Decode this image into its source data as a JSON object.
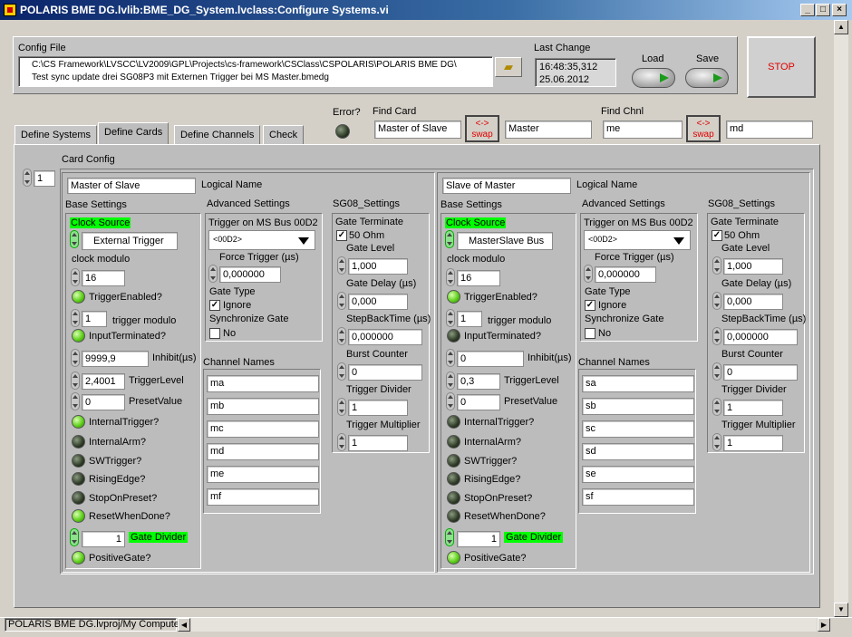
{
  "window": {
    "title": "POLARIS BME DG.lvlib:BME_DG_System.lvclass:Configure Systems.vi",
    "min": "_",
    "max": "□",
    "close": "×"
  },
  "config": {
    "label": "Config File",
    "path_line1": "C:\\CS Framework\\LVSCC\\LV2009\\GPL\\Projects\\cs-framework\\CSClass\\CSPOLARIS\\POLARIS BME DG\\",
    "path_line2": "Test sync update drei SG08P3 mit Externen Trigger bei MS Master.bmedg",
    "last_change_label": "Last Change",
    "time": "16:48:35,312",
    "date": "25.06.2012",
    "load": "Load",
    "save": "Save",
    "stop": "STOP"
  },
  "tabs": [
    "Define Systems",
    "Define Cards",
    "Define Channels",
    "Check"
  ],
  "error_label": "Error?",
  "find_card": {
    "label": "Find Card",
    "left": "Master of Slave",
    "swap": "<->\nswap",
    "right": "Master"
  },
  "find_chnl": {
    "label": "Find Chnl",
    "left": "me",
    "swap": "<->\nswap",
    "right": "md"
  },
  "card_config_label": "Card Config",
  "index": "1",
  "common": {
    "logical_name": "Logical Name",
    "base": "Base Settings",
    "adv": "Advanced Settings",
    "sg08": "SG08_Settings",
    "clock_source": "Clock Source",
    "clock_modulo": "clock modulo",
    "trigger_enabled": "TriggerEnabled?",
    "trigger_modulo": "trigger modulo",
    "input_terminated": "InputTerminated?",
    "inhibit": "Inhibit(µs)",
    "trigger_level": "TriggerLevel",
    "preset_value": "PresetValue",
    "internal_trigger": "InternalTrigger?",
    "internal_arm": "InternalArm?",
    "sw_trigger": "SWTrigger?",
    "rising_edge": "RisingEdge?",
    "stop_on_preset": "StopOnPreset?",
    "reset_when_done": "ResetWhenDone?",
    "gate_divider": "Gate Divider",
    "positive_gate": "PositiveGate?",
    "trig_ms": "Trigger on MS Bus 00D2",
    "ring": "<00D2>",
    "force_trigger": "Force Trigger (µs)",
    "gate_type": "Gate Type",
    "ignore": "Ignore",
    "sync_gate": "Synchronize Gate",
    "no": "No",
    "channel_names": "Channel Names",
    "gate_terminate": "Gate Terminate",
    "ohm": "50 Ohm",
    "gate_level": "Gate Level",
    "gate_delay": "Gate Delay (µs)",
    "stepback": "StepBackTime (µs)",
    "burst": "Burst Counter",
    "trig_div": "Trigger Divider",
    "trig_mult": "Trigger Multiplier"
  },
  "cards": [
    {
      "name": "Master of Slave",
      "clock": "External Trigger",
      "clock_modulo": "16",
      "trigger_modulo": "1",
      "inhibit": "9999,9",
      "trigger_level": "2,4001",
      "preset": "0",
      "gate_divider": "1",
      "force": "0,000000",
      "channels": [
        "ma",
        "mb",
        "mc",
        "md",
        "me",
        "mf"
      ],
      "gate_level": "1,000",
      "gate_delay": "0,000",
      "stepback": "0,000000",
      "burst": "0",
      "trig_div": "1",
      "trig_mult": "1"
    },
    {
      "name": "Slave of Master",
      "clock": "MasterSlave Bus",
      "clock_modulo": "16",
      "trigger_modulo": "1",
      "inhibit": "0",
      "trigger_level": "0,3",
      "preset": "0",
      "gate_divider": "1",
      "force": "0,000000",
      "channels": [
        "sa",
        "sb",
        "sc",
        "sd",
        "se",
        "sf"
      ],
      "gate_level": "1,000",
      "gate_delay": "0,000",
      "stepback": "0,000000",
      "burst": "0",
      "trig_div": "1",
      "trig_mult": "1"
    }
  ],
  "status": {
    "path": "POLARIS BME DG.lvproj/My Computer"
  }
}
